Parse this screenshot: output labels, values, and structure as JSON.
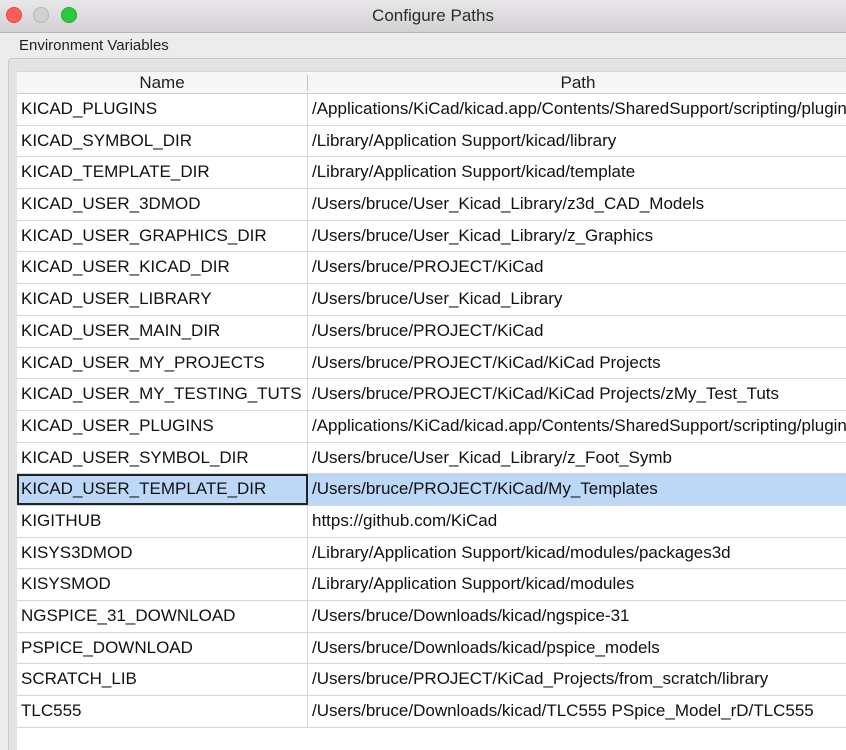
{
  "window": {
    "title": "Configure Paths"
  },
  "section": {
    "label": "Environment Variables"
  },
  "table": {
    "columns": [
      "Name",
      "Path"
    ],
    "selected_index": 12,
    "rows": [
      {
        "name": "KICAD_PLUGINS",
        "path": "/Applications/KiCad/kicad.app/Contents/SharedSupport/scripting/plugins"
      },
      {
        "name": "KICAD_SYMBOL_DIR",
        "path": "/Library/Application Support/kicad/library"
      },
      {
        "name": "KICAD_TEMPLATE_DIR",
        "path": "/Library/Application Support/kicad/template"
      },
      {
        "name": "KICAD_USER_3DMOD",
        "path": "/Users/bruce/User_Kicad_Library/z3d_CAD_Models"
      },
      {
        "name": "KICAD_USER_GRAPHICS_DIR",
        "path": "/Users/bruce/User_Kicad_Library/z_Graphics"
      },
      {
        "name": "KICAD_USER_KICAD_DIR",
        "path": "/Users/bruce/PROJECT/KiCad"
      },
      {
        "name": "KICAD_USER_LIBRARY",
        "path": "/Users/bruce/User_Kicad_Library"
      },
      {
        "name": "KICAD_USER_MAIN_DIR",
        "path": "/Users/bruce/PROJECT/KiCad"
      },
      {
        "name": "KICAD_USER_MY_PROJECTS",
        "path": "/Users/bruce/PROJECT/KiCad/KiCad Projects"
      },
      {
        "name": "KICAD_USER_MY_TESTING_TUTS",
        "path": "/Users/bruce/PROJECT/KiCad/KiCad Projects/zMy_Test_Tuts"
      },
      {
        "name": "KICAD_USER_PLUGINS",
        "path": "/Applications/KiCad/kicad.app/Contents/SharedSupport/scripting/plugins"
      },
      {
        "name": "KICAD_USER_SYMBOL_DIR",
        "path": "/Users/bruce/User_Kicad_Library/z_Foot_Symb"
      },
      {
        "name": "KICAD_USER_TEMPLATE_DIR",
        "path": "/Users/bruce/PROJECT/KiCad/My_Templates"
      },
      {
        "name": "KIGITHUB",
        "path": "https://github.com/KiCad"
      },
      {
        "name": "KISYS3DMOD",
        "path": "/Library/Application Support/kicad/modules/packages3d"
      },
      {
        "name": "KISYSMOD",
        "path": "/Library/Application Support/kicad/modules"
      },
      {
        "name": "NGSPICE_31_DOWNLOAD",
        "path": "/Users/bruce/Downloads/kicad/ngspice-31"
      },
      {
        "name": "PSPICE_DOWNLOAD",
        "path": "/Users/bruce/Downloads/kicad/pspice_models"
      },
      {
        "name": "SCRATCH_LIB",
        "path": "/Users/bruce/PROJECT/KiCad_Projects/from_scratch/library"
      },
      {
        "name": "TLC555",
        "path": "/Users/bruce/Downloads/kicad/TLC555 PSpice_Model_rD/TLC555"
      }
    ]
  },
  "colors": {
    "selection": "#bcd8f6",
    "close": "#fc5f57",
    "maximize": "#2ac940"
  }
}
